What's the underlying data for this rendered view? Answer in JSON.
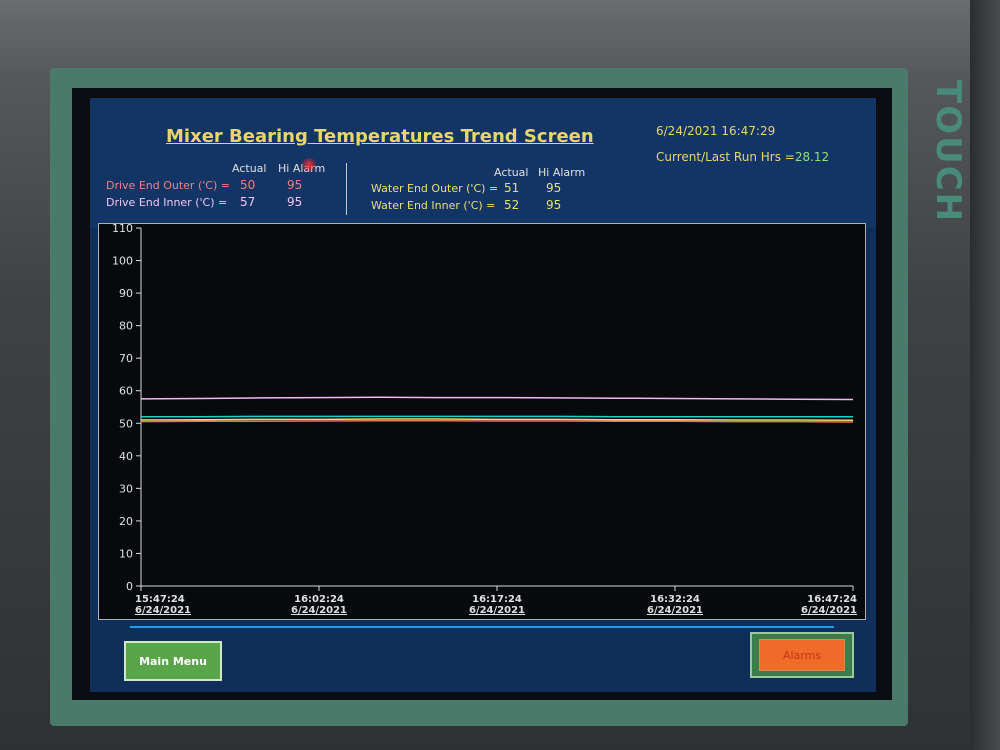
{
  "screen": {
    "title": "Mixer Bearing Temperatures Trend Screen",
    "datetime": "6/24/2021 16:47:29",
    "run_hours_label": "Current/Last Run Hrs =",
    "run_hours_value": "28.12",
    "bezel_label": "TOUCH"
  },
  "readings": {
    "left": {
      "header_actual": "Actual",
      "header_hi_alarm": "Hi Alarm",
      "rows": [
        {
          "label": "Drive End Outer ('C) =",
          "actual": "50",
          "hi_alarm": "95",
          "color": "#f08080"
        },
        {
          "label": "Drive End Inner ('C) =",
          "actual": "57",
          "hi_alarm": "95",
          "color": "#f0c8f0"
        }
      ]
    },
    "right": {
      "header_actual": "Actual",
      "header_hi_alarm": "Hi Alarm",
      "rows": [
        {
          "label": "Water End Outer ('C) =",
          "actual": "51",
          "hi_alarm": "95",
          "color": "#e8e070"
        },
        {
          "label": "Water End Inner ('C) =",
          "actual": "52",
          "hi_alarm": "95",
          "color": "#e8e070"
        }
      ]
    }
  },
  "chart_data": {
    "type": "line",
    "ylim": [
      0,
      110
    ],
    "yticks": [
      0,
      10,
      20,
      30,
      40,
      50,
      60,
      70,
      80,
      90,
      100,
      110
    ],
    "x_ticks": [
      {
        "time": "15:47:24",
        "date": "6/24/2021"
      },
      {
        "time": "16:02:24",
        "date": "6/24/2021"
      },
      {
        "time": "16:17:24",
        "date": "6/24/2021"
      },
      {
        "time": "16:32:24",
        "date": "6/24/2021"
      },
      {
        "time": "16:47:24",
        "date": "6/24/2021"
      }
    ],
    "x_minutes": [
      0,
      60
    ],
    "grid": false,
    "series": [
      {
        "values": [
          57.5,
          57.6,
          57.8,
          57.9,
          58.0,
          57.9,
          57.9,
          57.8,
          57.7,
          57.6,
          57.5,
          57.4,
          57.3
        ],
        "color": "#f0b8f0"
      },
      {
        "values": [
          52.0,
          52.0,
          52.1,
          52.1,
          52.1,
          52.1,
          52.1,
          52.1,
          52.0,
          52.0,
          52.0,
          52.0,
          52.0
        ],
        "color": "#20d0c0"
      },
      {
        "values": [
          51.0,
          51.1,
          51.2,
          51.2,
          51.3,
          51.3,
          51.2,
          51.2,
          51.1,
          51.1,
          51.0,
          51.0,
          50.9
        ],
        "color": "#e8e060"
      },
      {
        "values": [
          50.5,
          50.6,
          50.6,
          50.7,
          50.8,
          50.8,
          50.7,
          50.7,
          50.6,
          50.6,
          50.5,
          50.5,
          50.4
        ],
        "color": "#f07050"
      }
    ]
  },
  "buttons": {
    "main_menu": "Main Menu",
    "alarms": "Alarms"
  }
}
